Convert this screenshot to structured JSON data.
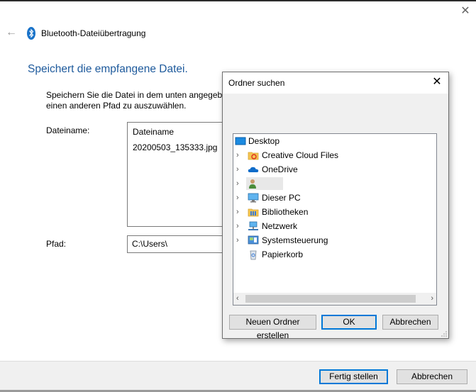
{
  "window": {
    "title": "Bluetooth-Dateiübertragung",
    "heading": "Speichert die empfangene Datei.",
    "description_line1": "Speichern Sie die Datei in dem unten angegebenen Pfad, oder klicken Sie auf „Durchsuchen“, um",
    "description_line2": "einen anderen Pfad zu auszuwählen.",
    "filename_label": "Dateiname:",
    "file_column_header": "Dateiname",
    "file_name": "20200503_135333.jpg",
    "path_label": "Pfad:",
    "path_value": "C:\\Users\\",
    "finish_button": "Fertig stellen",
    "cancel_button": "Abbrechen"
  },
  "folder_dialog": {
    "title": "Ordner suchen",
    "tree": [
      {
        "label": "Desktop",
        "icon": "desktop-icon",
        "expandable": false
      },
      {
        "label": "Creative Cloud Files",
        "icon": "creative-cloud-folder-icon",
        "expandable": true
      },
      {
        "label": "OneDrive",
        "icon": "onedrive-icon",
        "expandable": true
      },
      {
        "label": "",
        "icon": "user-icon",
        "expandable": true
      },
      {
        "label": "Dieser PC",
        "icon": "computer-icon",
        "expandable": true
      },
      {
        "label": "Bibliotheken",
        "icon": "libraries-icon",
        "expandable": true
      },
      {
        "label": "Netzwerk",
        "icon": "network-icon",
        "expandable": true
      },
      {
        "label": "Systemsteuerung",
        "icon": "control-panel-icon",
        "expandable": true
      },
      {
        "label": "Papierkorb",
        "icon": "recycle-bin-icon",
        "expandable": false
      }
    ],
    "new_folder_button": "Neuen Ordner erstellen",
    "ok_button": "OK",
    "cancel_button": "Abbrechen"
  },
  "colors": {
    "heading": "#1e5a9c",
    "accent": "#0078d7"
  }
}
